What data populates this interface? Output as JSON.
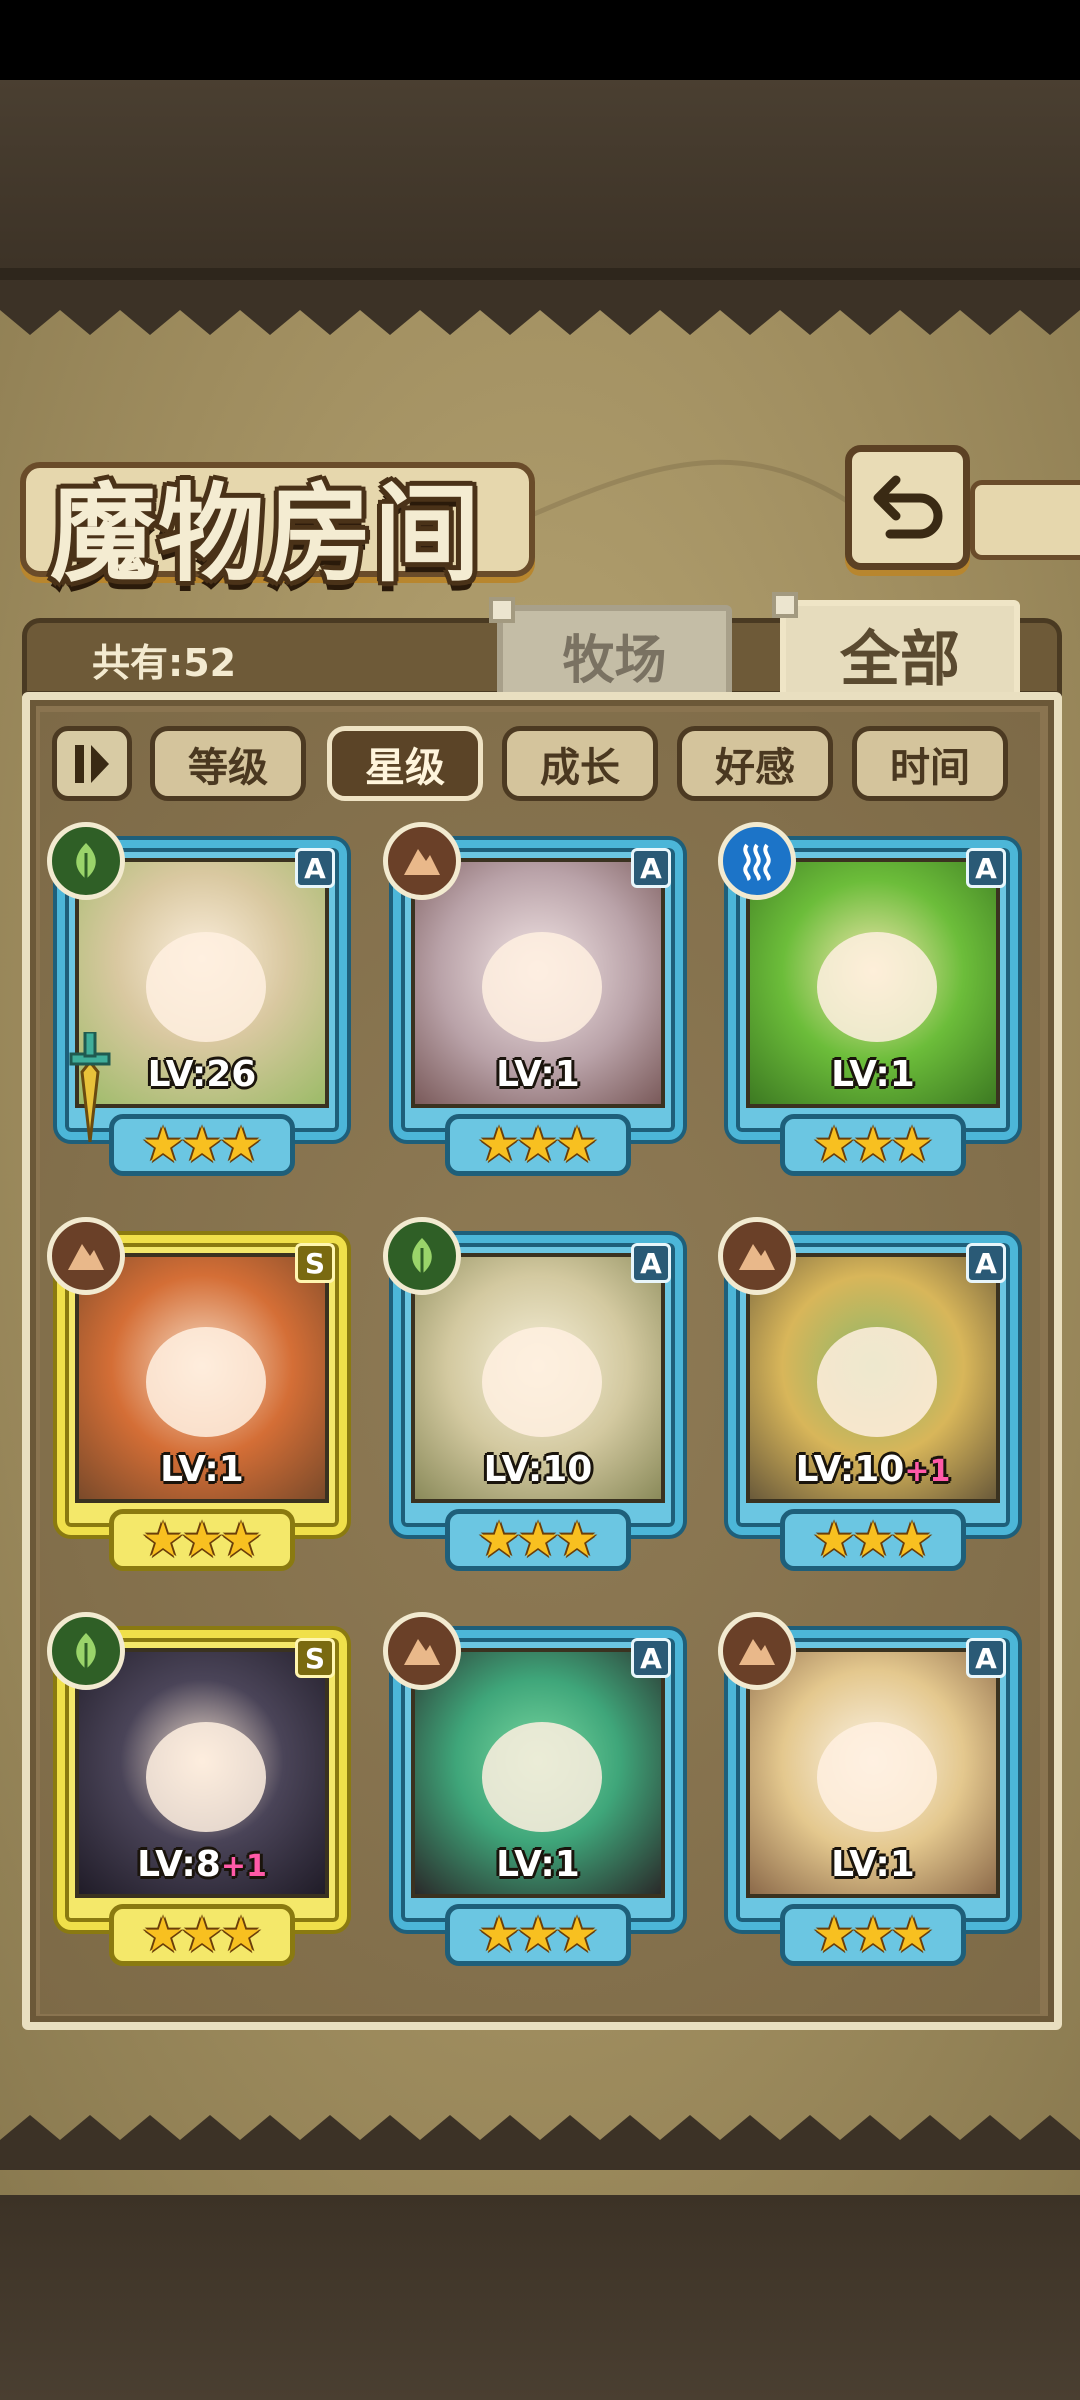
{
  "title": "魔物房间",
  "count_label": "共有:52",
  "tabs": [
    {
      "label": "牧场",
      "active": false
    },
    {
      "label": "全部",
      "active": true
    }
  ],
  "filters": [
    {
      "label": "等级",
      "active": false
    },
    {
      "label": "星级",
      "active": true
    },
    {
      "label": "成长",
      "active": false
    },
    {
      "label": "好感",
      "active": false
    },
    {
      "label": "时间",
      "active": false
    }
  ],
  "monsters": [
    {
      "level": "LV:26",
      "plus": "",
      "rank": "A",
      "element": "nature",
      "stars": 3,
      "equipped_weapon": true
    },
    {
      "level": "LV:1",
      "plus": "",
      "rank": "A",
      "element": "earth",
      "stars": 3,
      "equipped_weapon": false
    },
    {
      "level": "LV:1",
      "plus": "",
      "rank": "A",
      "element": "water",
      "stars": 3,
      "equipped_weapon": false
    },
    {
      "level": "LV:1",
      "plus": "",
      "rank": "S",
      "element": "earth",
      "stars": 3,
      "equipped_weapon": false
    },
    {
      "level": "LV:10",
      "plus": "",
      "rank": "A",
      "element": "nature",
      "stars": 3,
      "equipped_weapon": false
    },
    {
      "level": "LV:10",
      "plus": "+1",
      "rank": "A",
      "element": "earth",
      "stars": 3,
      "equipped_weapon": false
    },
    {
      "level": "LV:8",
      "plus": "+1",
      "rank": "S",
      "element": "nature",
      "stars": 3,
      "equipped_weapon": false
    },
    {
      "level": "LV:1",
      "plus": "",
      "rank": "A",
      "element": "earth",
      "stars": 3,
      "equipped_weapon": false
    },
    {
      "level": "LV:1",
      "plus": "",
      "rank": "A",
      "element": "earth",
      "stars": 3,
      "equipped_weapon": false
    }
  ],
  "colors": {
    "rank_a_frame": "#4cb6d8",
    "rank_s_frame": "#f0e04a",
    "star": "#f8c020",
    "plus_level": "#ff5aa8",
    "element_nature": "#2f5f26",
    "element_earth": "#6a4028",
    "element_water": "#1c74c8"
  },
  "icons": {
    "back": "return-arrow-icon",
    "sort_toggle": "sort-order-icon",
    "element_nature": "leaf-icon",
    "element_earth": "mountain-icon",
    "element_water": "water-wave-icon",
    "star": "star-icon",
    "weapon": "sword-icon"
  }
}
